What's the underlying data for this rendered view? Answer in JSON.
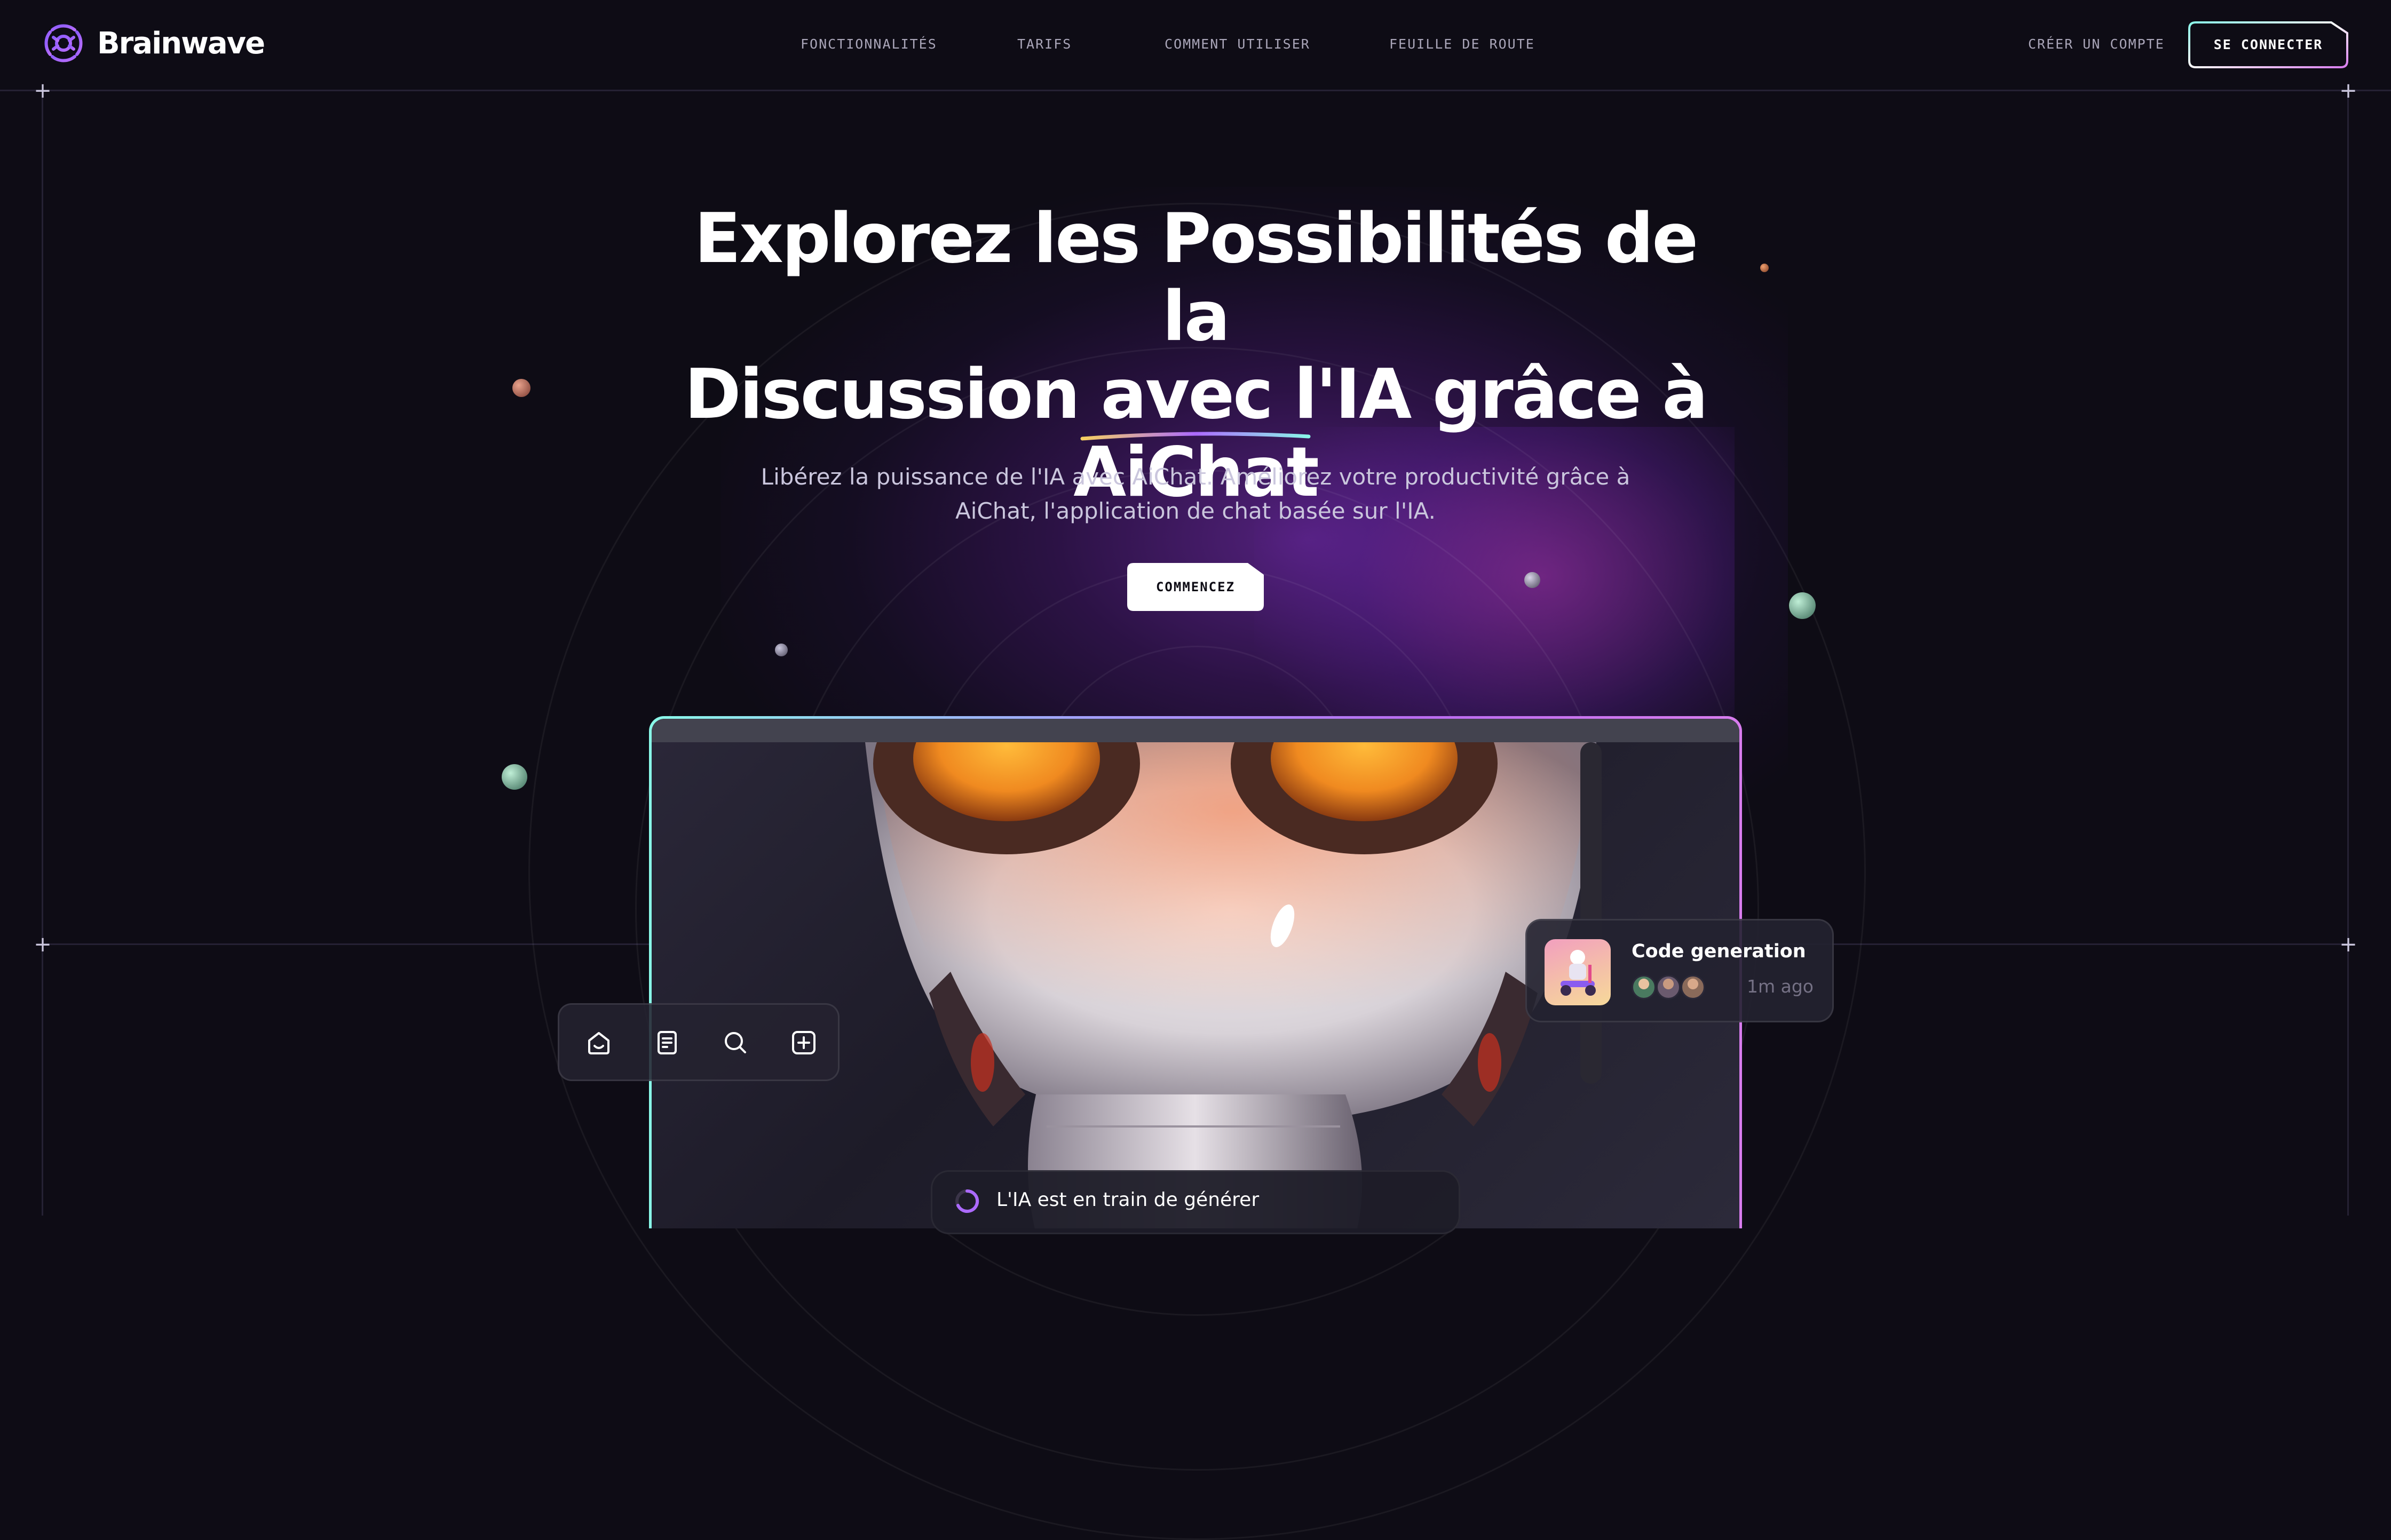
{
  "brand": {
    "name": "Brainwave"
  },
  "nav": {
    "items": [
      {
        "label": "FONCTIONNALITÉS"
      },
      {
        "label": "TARIFS"
      },
      {
        "label": "COMMENT UTILISER"
      },
      {
        "label": "FEUILLE DE ROUTE"
      }
    ],
    "signup_label": "CRÉER UN COMPTE",
    "login_label": "SE CONNECTER"
  },
  "hero": {
    "title_line1": "Explorez les Possibilités de la",
    "title_line2": "Discussion avec l'IA grâce à",
    "title_highlight": "AiChat",
    "subtitle": "Libérez la puissance de l'IA avec AiChat. Améliorez votre productivité grâce à AiChat, l'application de chat basée sur l'IA.",
    "cta_label": "COMMENCEZ"
  },
  "toolbar": {
    "icons": [
      "home-icon",
      "document-icon",
      "search-icon",
      "add-square-icon"
    ]
  },
  "notification_card": {
    "title": "Code generation",
    "time": "1m ago",
    "thumbnail_icon": "robot-on-scooter-illustration"
  },
  "status": {
    "text": "L'IA est en train de générer",
    "icon": "loading-spinner-icon"
  },
  "colors": {
    "background": "#0e0c15",
    "border": "#252134",
    "nav_text": "#aaa6b9",
    "subtitle": "#cac6dd",
    "accent_purple": "#ac6aff",
    "accent_cyan": "#89f9e8",
    "accent_pink": "#d87cee"
  }
}
